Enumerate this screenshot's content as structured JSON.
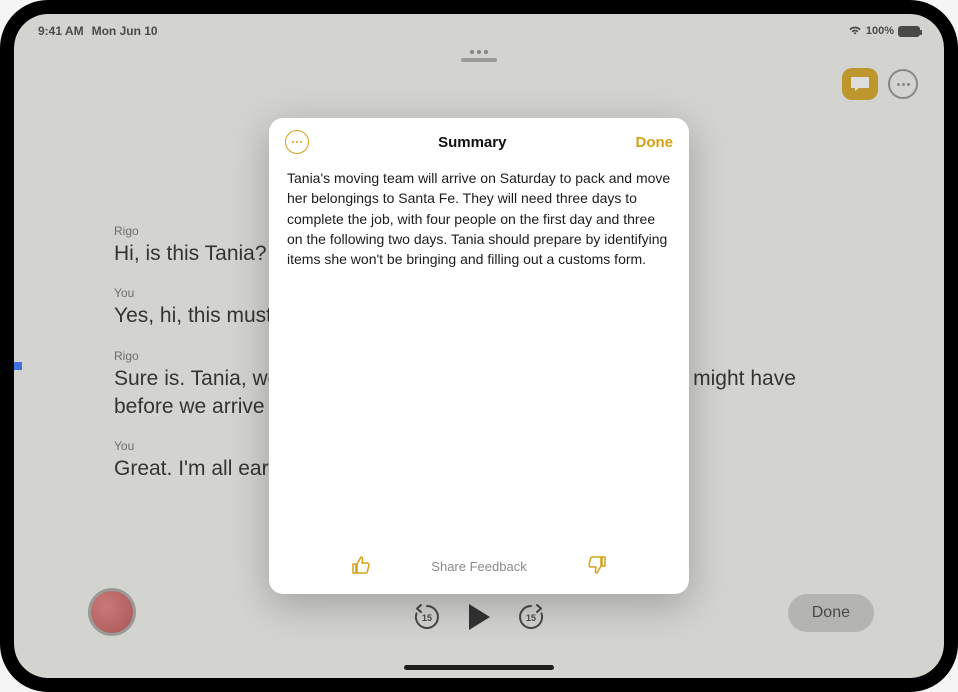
{
  "status": {
    "time": "9:41 AM",
    "date": "Mon Jun 10",
    "battery": "100%"
  },
  "transcript": [
    {
      "speaker": "Rigo",
      "text": "Hi, is this Tania?"
    },
    {
      "speaker": "You",
      "text": "Yes, hi, this must be l"
    },
    {
      "speaker": "Rigo",
      "text": "Sure is. Tania, we're d                                                       o chat with you beforehand to go ove                                                      u might have before we arrive Saturday m"
    },
    {
      "speaker": "You",
      "text": "Great. I'm all ears."
    }
  ],
  "modal": {
    "title": "Summary",
    "done": "Done",
    "body": "Tania's moving team will arrive on Saturday to pack and move her belongings to Santa Fe. They will need three days to complete the job, with four people on the first day and three on the following two days. Tania should prepare by identifying items she won't be bringing and filling out a customs form.",
    "feedback": "Share Feedback"
  },
  "bottom": {
    "done": "Done"
  }
}
